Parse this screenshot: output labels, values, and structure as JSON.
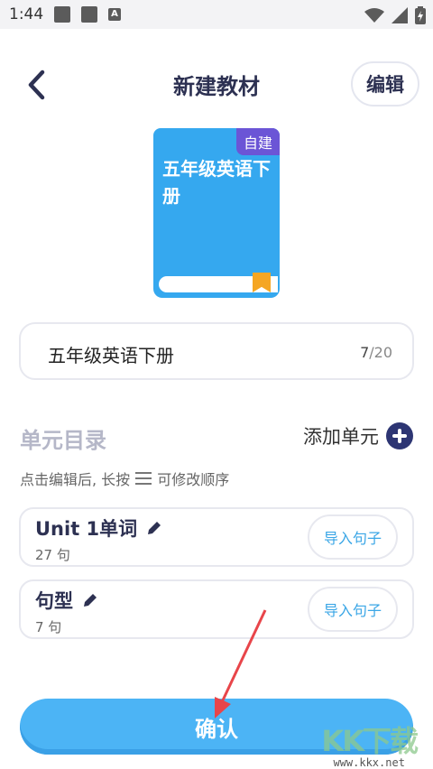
{
  "status_bar": {
    "time": "1:44",
    "a_glyph": "A"
  },
  "header": {
    "title": "新建教材",
    "edit_label": "编辑"
  },
  "book": {
    "tag": "自建",
    "title": "五年级英语下册"
  },
  "name_field": {
    "value": "五年级英语下册",
    "count_current": "7",
    "count_max": "/20"
  },
  "units_section": {
    "title": "单元目录",
    "add_label": "添加单元",
    "hint_before": "点击编辑后, 长按",
    "hint_after": "可修改顺序"
  },
  "units": [
    {
      "name": "Unit 1单词",
      "count": "27 句",
      "import_label": "导入句子"
    },
    {
      "name": "句型",
      "count": "7 句",
      "import_label": "导入句子"
    }
  ],
  "confirm_label": "确认",
  "watermark": {
    "logo": "KK下载",
    "url": "www.kkx.net"
  },
  "colors": {
    "accent": "#4cb4f5",
    "navy": "#2d3573",
    "tag_purple": "#6b55d6",
    "ribbon": "#f5a623",
    "annotation_red": "#e8454a"
  },
  "icons": [
    "back-chevron-icon",
    "plus-circle-icon",
    "menu-lines-icon",
    "pencil-icon",
    "wifi-icon",
    "signal-icon",
    "battery-icon"
  ]
}
